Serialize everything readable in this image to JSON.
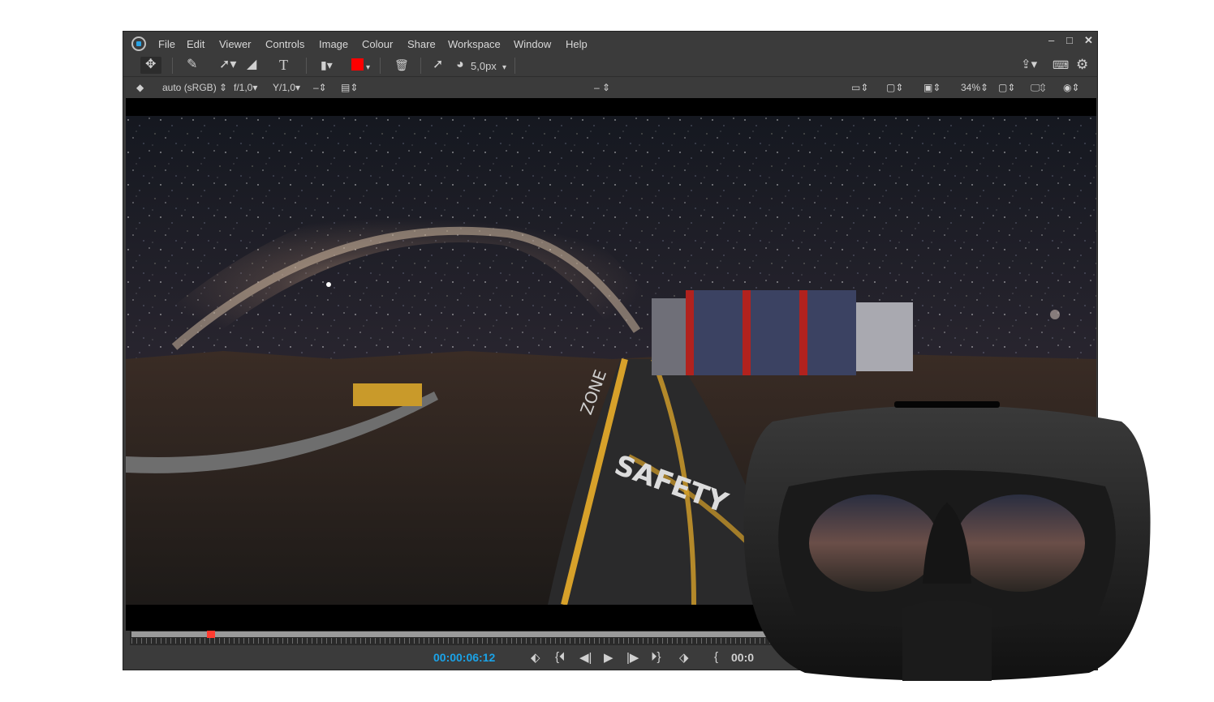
{
  "menu": [
    "File",
    "Edit",
    "Viewer",
    "Controls",
    "Image",
    "Colour",
    "Share",
    "Workspace",
    "Window",
    "Help"
  ],
  "window_controls": {
    "minimize": "–",
    "maximize": "□",
    "close": "✕"
  },
  "toolbar": {
    "brush_size": "5,0px",
    "stroke_color": "#ff0000"
  },
  "viewbar": {
    "colorspace": "auto (sRGB)",
    "f_stop": "f/1,0",
    "gamma": "Y/1,0",
    "mid": "–",
    "zoom": "34%"
  },
  "scene_text": [
    "ZONE",
    "SAFETY"
  ],
  "transport": {
    "timecode": "00:00:06:12",
    "timecode_right": "00:0",
    "timecode_color": "#1aa3e8"
  },
  "timeline": {
    "playhead_progress": 0.08
  },
  "accent": "#1aa3e8",
  "icons": [
    "move-icon",
    "brush-icon",
    "arrow-icon",
    "eraser-icon",
    "text-icon",
    "compare-icon",
    "color-swatch-icon",
    "trash-icon",
    "pointer-icon",
    "brush-size-icon",
    "share-icon",
    "keyboard-icon",
    "gear-icon",
    "layers-icon",
    "eye-icon",
    "monitor-icon"
  ]
}
